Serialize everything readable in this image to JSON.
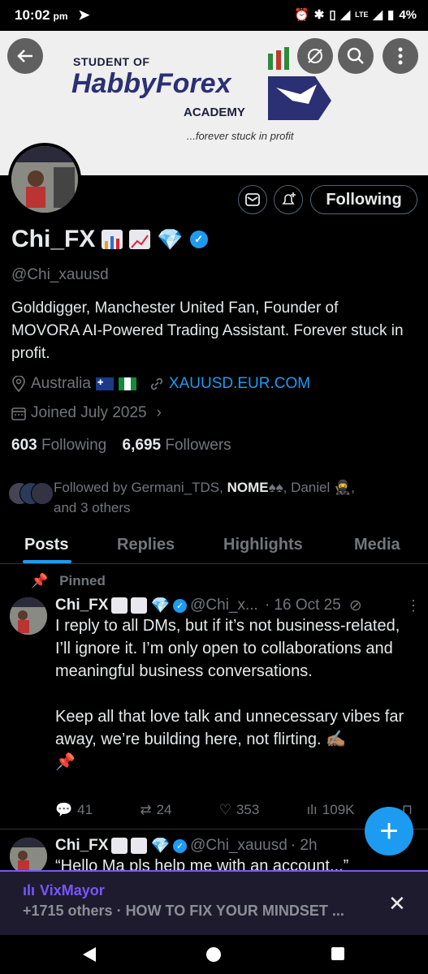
{
  "status_bar": {
    "time": "10:02",
    "ampm": "pm",
    "network": "LTE",
    "battery": "4%"
  },
  "banner": {
    "line1": "STUDENT OF",
    "line2": "HabbyForex",
    "line3": "ACADEMY",
    "tagline": "...forever stuck in profit"
  },
  "header_buttons": {
    "back": "back",
    "menu": "more"
  },
  "profile": {
    "name": "Chi_FX",
    "handle": "@Chi_xauusd",
    "bio": "Golddigger, Manchester United Fan, Founder of MOVORA AI-Powered Trading Assistant. Forever stuck in profit.",
    "location": "Australia",
    "link": "XAUUSD.EUR.COM",
    "joined": "Joined July 2025",
    "following_count": "603",
    "following_label": "Following",
    "followers_count": "6,695",
    "followers_label": "Followers",
    "follow_button": "Following",
    "followed_by_prefix": "Followed by",
    "followed_by_1": "Germani_TDS,",
    "followed_by_2": "NOME",
    "followed_by_3": ", Daniel",
    "followed_by_more": "and 3 others"
  },
  "tabs": [
    "Posts",
    "Replies",
    "Highlights",
    "Media"
  ],
  "pinned_label": "Pinned",
  "tweets": [
    {
      "name": "Chi_FX",
      "handle": "@Chi_x...",
      "time": "· 16 Oct 25",
      "text_p1": "I reply to all DMs, but if it’s not business-related, I’ll ignore it. I’m only open to collaborations and meaningful business conversations.",
      "text_p2": "Keep all that love talk and unnecessary vibes far away, we’re building here, not flirting.",
      "replies": "41",
      "retweets": "24",
      "likes": "353",
      "views": "109K"
    },
    {
      "name": "Chi_FX",
      "handle": "@Chi_xauusd",
      "time": "· 2h",
      "text": "“Hello Ma pls help me with an account...”"
    }
  ],
  "space": {
    "host": "VixMayor",
    "subtitle": "+1715 others · HOW TO FIX YOUR MINDSET ..."
  },
  "colors": {
    "accent": "#1d9bf0",
    "space_purple": "#7856ff"
  }
}
